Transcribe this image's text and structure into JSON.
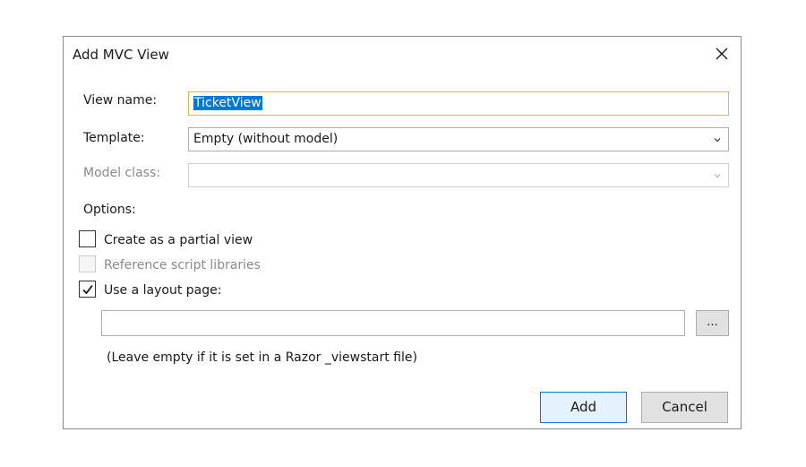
{
  "dialog": {
    "title": "Add MVC View",
    "close_icon": "close-icon"
  },
  "form": {
    "view_name": {
      "label": "View name:",
      "value": "TicketView"
    },
    "template": {
      "label": "Template:",
      "selected": "Empty (without model)"
    },
    "model_class": {
      "label": "Model class:",
      "selected": "",
      "enabled": false
    }
  },
  "options": {
    "heading": "Options:",
    "partial_view": {
      "label": "Create as a partial view",
      "checked": false,
      "enabled": true
    },
    "script_libraries": {
      "label": "Reference script libraries",
      "checked": false,
      "enabled": false
    },
    "layout_page": {
      "label": "Use a layout page:",
      "checked": true,
      "enabled": true
    },
    "layout_path": "",
    "browse_label": "...",
    "hint": "(Leave empty if it is set in a Razor _viewstart file)"
  },
  "buttons": {
    "add": "Add",
    "cancel": "Cancel"
  },
  "colors": {
    "selection": "#0078d7",
    "focus_border": "#e3b545",
    "default_button_border": "#0078d7"
  }
}
